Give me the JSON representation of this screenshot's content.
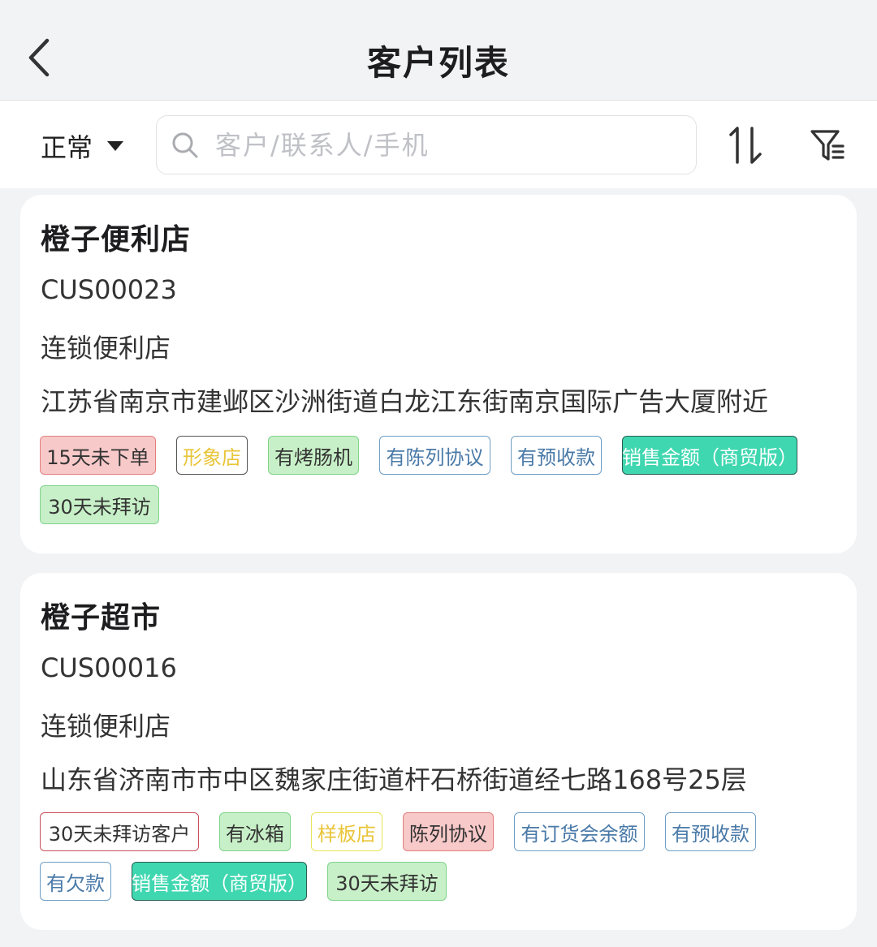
{
  "header": {
    "title": "客户列表"
  },
  "toolbar": {
    "status": "正常",
    "search_placeholder": "客户/联系人/手机"
  },
  "customers": [
    {
      "name": "橙子便利店",
      "code": "CUS00023",
      "type": "连锁便利店",
      "address": "江苏省南京市建邺区沙洲街道白龙江东街南京国际广告大厦附近",
      "tags": [
        "15天未下单",
        "形象店",
        "有烤肠机",
        "有陈列协议",
        "有预收款",
        "销售金额（商贸版）",
        "30天未拜访"
      ]
    },
    {
      "name": "橙子超市",
      "code": "CUS00016",
      "type": "连锁便利店",
      "address": "山东省济南市市中区魏家庄街道杆石桥街道经七路168号25层",
      "tags": [
        "30天未拜访客户",
        "有冰箱",
        "样板店",
        "陈列协议",
        "有订货会余额",
        "有预收款",
        "有欠款",
        "销售金额（商贸版）",
        "30天未拜访"
      ]
    }
  ]
}
